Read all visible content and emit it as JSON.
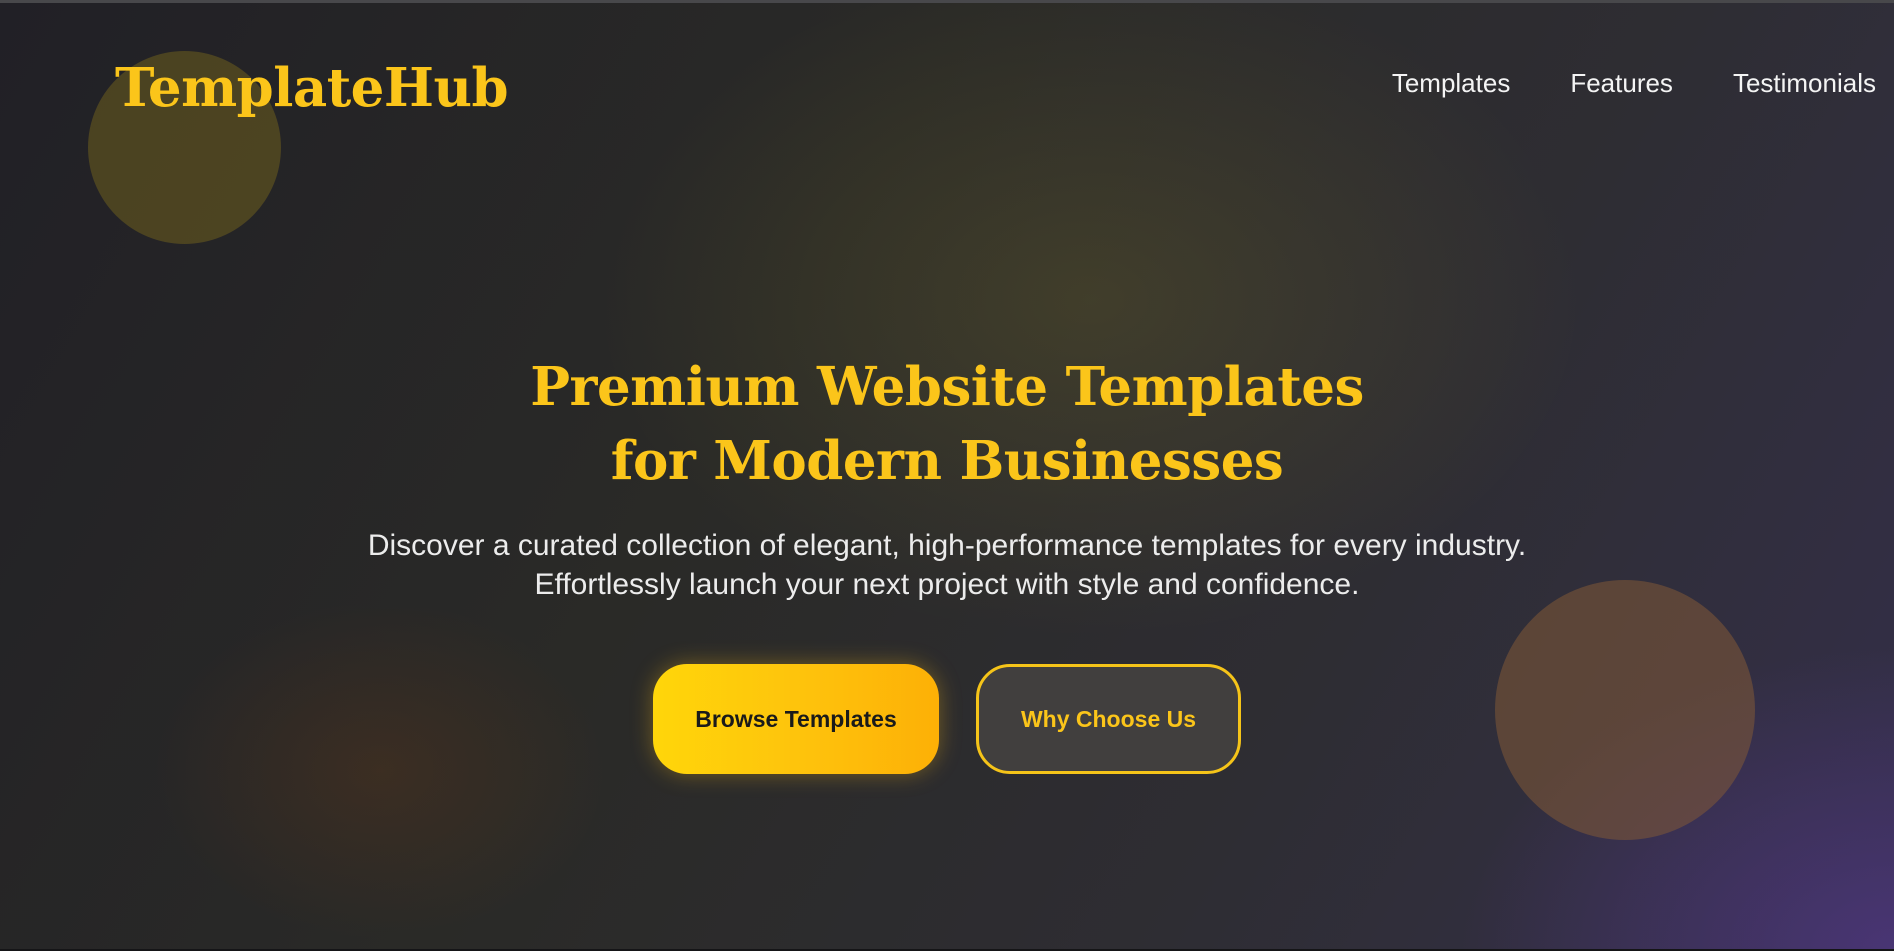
{
  "brand": {
    "name": "TemplateHub",
    "accent_color": "#fbc51a"
  },
  "nav": {
    "links": [
      {
        "label": "Templates"
      },
      {
        "label": "Features"
      },
      {
        "label": "Testimonials"
      }
    ]
  },
  "hero": {
    "title_line1": "Premium Website Templates",
    "title_line2": "for Modern Businesses",
    "subtitle_line1": "Discover a curated collection of elegant, high-performance templates for every industry.",
    "subtitle_line2": "Effortlessly launch your next project with style and confidence."
  },
  "cta": {
    "primary_label": "Browse Templates",
    "secondary_label": "Why Choose Us"
  }
}
